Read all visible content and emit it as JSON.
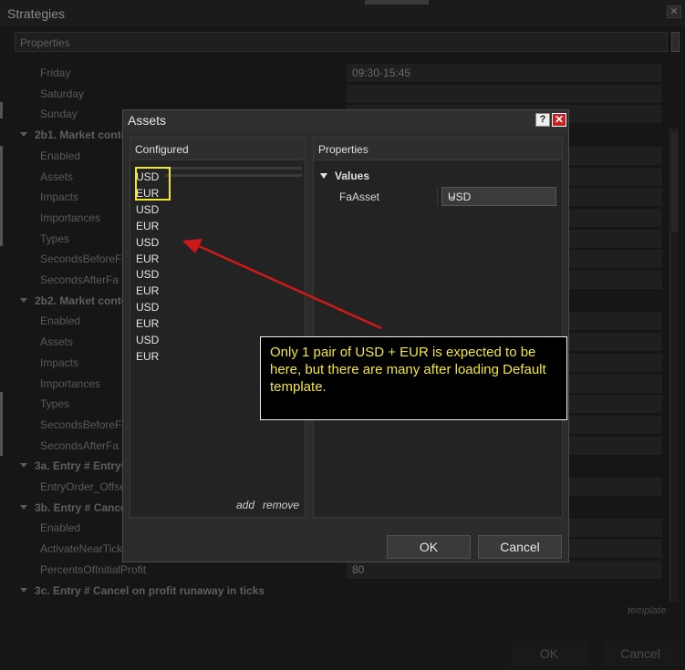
{
  "window": {
    "title": "Strategies",
    "close_glyph": "✕"
  },
  "properties_bar": {
    "label": "Properties"
  },
  "rows": [
    {
      "label": "Friday",
      "value": "09:30-15:45"
    },
    {
      "label": "Saturday",
      "value": ""
    },
    {
      "label": "Sunday",
      "value": ""
    },
    {
      "label": "2b1. Market conte",
      "category": true
    },
    {
      "label": "Enabled",
      "value": ""
    },
    {
      "label": "Assets",
      "value": ""
    },
    {
      "label": "Impacts",
      "value": ""
    },
    {
      "label": "Importances",
      "value": ""
    },
    {
      "label": "Types",
      "value": ""
    },
    {
      "label": "SecondsBeforeFa",
      "value": ""
    },
    {
      "label": "SecondsAfterFa",
      "value": ""
    },
    {
      "label": "2b2. Market conte",
      "category": true
    },
    {
      "label": "Enabled",
      "value": ""
    },
    {
      "label": "Assets",
      "value": ""
    },
    {
      "label": "Impacts",
      "value": ""
    },
    {
      "label": "Importances",
      "value": ""
    },
    {
      "label": "Types",
      "value": ""
    },
    {
      "label": "SecondsBeforeFa",
      "value": ""
    },
    {
      "label": "SecondsAfterFa",
      "value": ""
    },
    {
      "label": "3a. Entry # EntryO",
      "category": true
    },
    {
      "label": "EntryOrder_Offse",
      "value": ""
    },
    {
      "label": "3b. Entry # Cancel",
      "category": true
    },
    {
      "label": "Enabled",
      "value": ""
    },
    {
      "label": "ActivateNearTicks",
      "value": ""
    },
    {
      "label": "PercentsOfInitialProfit",
      "value": "80"
    },
    {
      "label": "3c. Entry # Cancel on profit runaway in ticks",
      "category": true
    }
  ],
  "template_link": "template",
  "outer_buttons": {
    "ok": "OK",
    "cancel": "Cancel"
  },
  "dialog": {
    "title": "Assets",
    "help_glyph": "?",
    "close_glyph": "✕",
    "configured_header": "Configured",
    "properties_header": "Properties",
    "configured_items": [
      "USD",
      "EUR",
      "USD",
      "EUR",
      "USD",
      "EUR",
      "USD",
      "EUR",
      "USD",
      "EUR",
      "USD",
      "EUR"
    ],
    "add_link": "add",
    "remove_link": "remove",
    "values_label": "Values",
    "fa_asset_label": "FaAsset",
    "fa_asset_value": "USD",
    "ok_label": "OK",
    "cancel_label": "Cancel"
  },
  "annotation": {
    "text": "Only 1 pair of USD + EUR is expected to be here, but there are many after loading Default template.",
    "text_color": "#f2e63a",
    "arrow_color": "#d01818",
    "highlight_color": "#f0e830"
  }
}
